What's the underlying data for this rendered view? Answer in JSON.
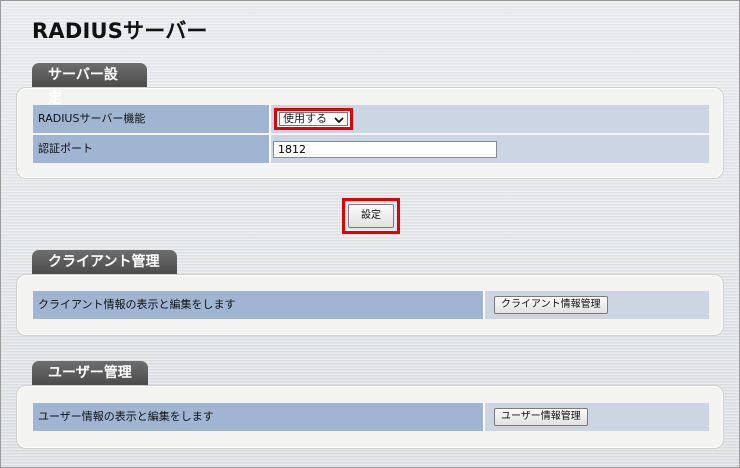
{
  "page": {
    "title": "RADIUSサーバー"
  },
  "server_settings": {
    "tab_label": "サーバー設定",
    "rows": [
      {
        "label": "RADIUSサーバー機能",
        "control": "select",
        "value": "使用する"
      },
      {
        "label": "認証ポート",
        "control": "input",
        "value": "1812"
      }
    ]
  },
  "actions": {
    "set_label": "設定"
  },
  "client_management": {
    "tab_label": "クライアント管理",
    "description": "クライアント情報の表示と編集をします",
    "button_label": "クライアント情報管理"
  },
  "user_management": {
    "tab_label": "ユーザー管理",
    "description": "ユーザー情報の表示と編集をします",
    "button_label": "ユーザー情報管理"
  },
  "icons": {
    "select_arrow": "chevron-down-icon"
  },
  "colors": {
    "highlight": "#e00000",
    "label_cell": "#9fb5d2",
    "value_cell": "#cbd5e4",
    "tab_background": "#5a5a5a"
  }
}
